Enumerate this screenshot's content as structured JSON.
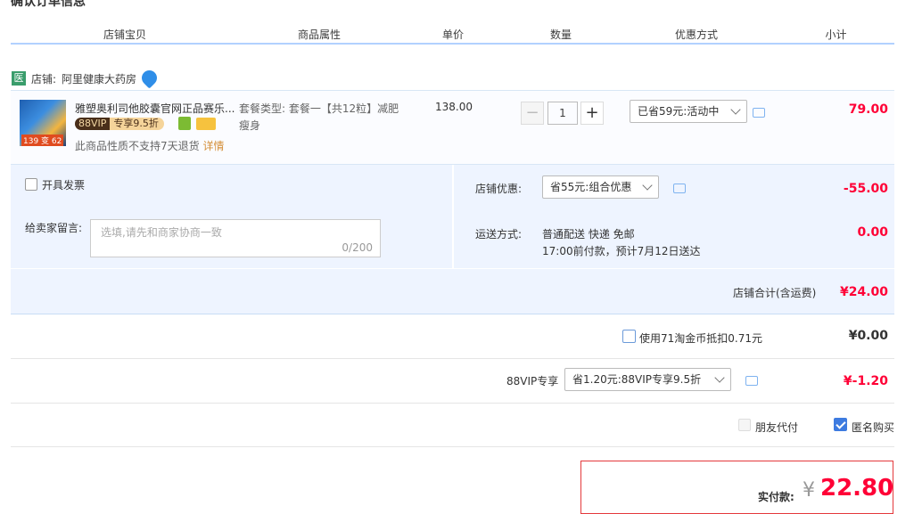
{
  "page": {
    "title": "确认订单信息"
  },
  "columns": [
    "店铺宝贝",
    "商品属性",
    "单价",
    "数量",
    "优惠方式",
    "小计"
  ],
  "shop": {
    "icon_text": "医",
    "label": "店铺:",
    "name": "阿里健康大药房"
  },
  "item": {
    "name": "雅塑奥利司他胶囊官网正品赛乐...",
    "vip_label": "88VIP",
    "vip_discount": "专享9.5折",
    "attr": "套餐类型: 套餐一【共12粒】减肥瘦身",
    "thumb_text": "139 变 62",
    "notice": "此商品性质不支持7天退货",
    "notice_link": "详情",
    "price": "138.00",
    "quantity": "1",
    "minus": "−",
    "plus": "+",
    "discount_select": "已省59元:活动中",
    "subtotal": "79.00"
  },
  "invoice": {
    "label": "开具发票"
  },
  "message": {
    "label": "给卖家留言:",
    "placeholder": "选填,请先和商家协商一致",
    "counter": "0/200"
  },
  "shop_discount": {
    "label": "店铺优惠:",
    "select": "省55元:组合优惠",
    "amount": "-55.00"
  },
  "shipping": {
    "label": "运送方式:",
    "method": "普通配送 快递 免邮",
    "eta": "17:00前付款，预计7月12日送达",
    "amount": "0.00"
  },
  "shop_total": {
    "label": "店铺合计(含运费)",
    "amount": "¥24.00"
  },
  "coins": {
    "label": "使用71淘金币抵扣0.71元",
    "amount": "¥0.00"
  },
  "vip": {
    "label": "88VIP专享",
    "select": "省1.20元:88VIP专享9.5折",
    "amount": "¥-1.20"
  },
  "options": {
    "friend_pay": "朋友代付",
    "anonymous": "匿名购买"
  },
  "payment": {
    "label": "实付款:",
    "currency": "¥",
    "amount": "22.80"
  },
  "colors": {
    "accent_red": "#ff0036",
    "header_border": "#b2d1ff",
    "panel_blue": "#eef4ff"
  }
}
